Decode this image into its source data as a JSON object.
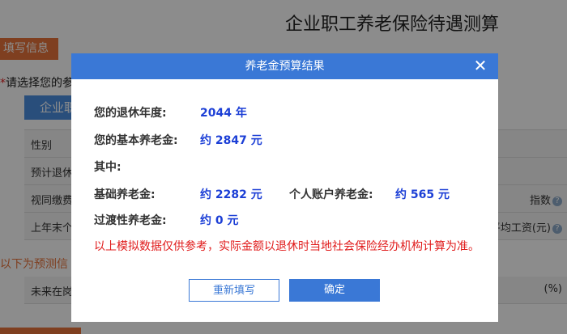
{
  "page": {
    "title": "企业职工养老保险待遇测算",
    "fill_tab": "填写信息",
    "prompt_star": "*",
    "prompt_text": "请选择您的参",
    "type_button": "企业职",
    "rows": [
      {
        "label": "性别",
        "right": ""
      },
      {
        "label": "预计退休",
        "right": ""
      },
      {
        "label": "视同缴费",
        "right": "指数"
      },
      {
        "label": "上年末个",
        "right": "平均工资(元)"
      }
    ],
    "predict_text": "以下为预测信",
    "future_row_label": "未来在岗",
    "future_row_right": "(%)"
  },
  "modal": {
    "title": "养老金预算结果",
    "close_symbol": "✕",
    "retire_year_label": "您的退休年度:",
    "retire_year_value": "2044 年",
    "basic_pension_label": "您的基本养老金:",
    "basic_pension_value": "约 2847 元",
    "among_label": "其中:",
    "base_pension_label": "基础养老金:",
    "base_pension_value": "约 2282 元",
    "personal_account_label": "个人账户养老金:",
    "personal_account_value": "约 565 元",
    "transition_label": "过渡性养老金:",
    "transition_value": "约 0 元",
    "note": "以上模拟数据仅供参考，实际金额以退休时当地社会保险经办机构计算为准。",
    "reset_button": "重新填写",
    "ok_button": "确定"
  },
  "colors": {
    "accent_orange": "#e8733b",
    "modal_blue": "#3a78d6",
    "value_blue": "#1c3fd6",
    "note_red": "#e01b1b"
  }
}
